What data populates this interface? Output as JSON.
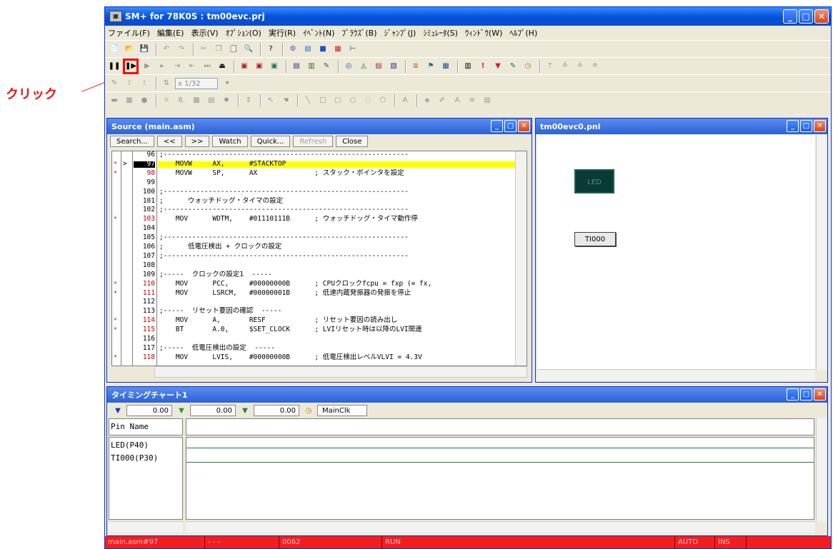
{
  "annotation": {
    "label": "クリック",
    "color": "#ee1111"
  },
  "app": {
    "title": "SM+ for 78K0S : tm00evc.prj",
    "menus": [
      "ファイル(F)",
      "編集(E)",
      "表示(V)",
      "ｵﾌﾟｼｮﾝ(O)",
      "実行(R)",
      "ｲﾍﾞﾝﾄ(N)",
      "ﾌﾞﾗｳｽﾞ(B)",
      "ｼﾞｬﾝﾌﾟ(J)",
      "ｼﾐｭﾚｰﾀ(S)",
      "ｳｨﾝﾄﾞｳ(W)",
      "ﾍﾙﾌﾟ(H)"
    ],
    "zoom": "x 1/32"
  },
  "source_window": {
    "title": "Source (main.asm)",
    "buttons": {
      "search": "Search...",
      "back": "<<",
      "forward": ">>",
      "watch": "Watch",
      "quick": "Quick...",
      "refresh": "Refresh",
      "close": "Close"
    },
    "lines": [
      {
        "n": "96",
        "text": ";------------------------------------------------------------",
        "bp": false,
        "red": false,
        "hl": false
      },
      {
        "n": "97",
        "text": "    MOVW     AX,      #STACKTOP",
        "bp": true,
        "red": true,
        "hl": true
      },
      {
        "n": "98",
        "text": "    MOVW     SP,      AX              ; スタック・ポインタを設定",
        "bp": true,
        "red": true,
        "hl": false
      },
      {
        "n": "99",
        "text": "",
        "bp": false,
        "red": false,
        "hl": false
      },
      {
        "n": "100",
        "text": ";------------------------------------------------------------",
        "bp": false,
        "red": false,
        "hl": false
      },
      {
        "n": "101",
        "text": ";      ウォッチドッグ・タイマの設定",
        "bp": false,
        "red": false,
        "hl": false
      },
      {
        "n": "102",
        "text": ";------------------------------------------------------------",
        "bp": false,
        "red": false,
        "hl": false
      },
      {
        "n": "103",
        "text": "    MOV      WDTM,    #01110111B      ; ウォッチドッグ・タイマ動作停",
        "bp": true,
        "red": true,
        "hl": false
      },
      {
        "n": "104",
        "text": "",
        "bp": false,
        "red": false,
        "hl": false
      },
      {
        "n": "105",
        "text": ";------------------------------------------------------------",
        "bp": false,
        "red": false,
        "hl": false
      },
      {
        "n": "106",
        "text": ";      低電圧検出 + クロックの設定",
        "bp": false,
        "red": false,
        "hl": false
      },
      {
        "n": "107",
        "text": ";------------------------------------------------------------",
        "bp": false,
        "red": false,
        "hl": false
      },
      {
        "n": "108",
        "text": "",
        "bp": false,
        "red": false,
        "hl": false
      },
      {
        "n": "109",
        "text": ";-----  クロックの設定1  -----",
        "bp": false,
        "red": false,
        "hl": false
      },
      {
        "n": "110",
        "text": "    MOV      PCC,     #00000000B      ; CPUクロックfcpu = fxp (= fx,",
        "bp": true,
        "red": true,
        "hl": false
      },
      {
        "n": "111",
        "text": "    MOV      LSRCM,   #00000001B      ; 低速内蔵発振器の発振を停止",
        "bp": true,
        "red": true,
        "hl": false
      },
      {
        "n": "112",
        "text": "",
        "bp": false,
        "red": false,
        "hl": false
      },
      {
        "n": "113",
        "text": ";-----  リセット要因の確認  -----",
        "bp": false,
        "red": false,
        "hl": false
      },
      {
        "n": "114",
        "text": "    MOV      A,       RESF            ; リセット要因の読み出し",
        "bp": true,
        "red": true,
        "hl": false
      },
      {
        "n": "115",
        "text": "    BT       A.0,     $SET_CLOCK      ; LVIリセット時は以降のLVI関連",
        "bp": true,
        "red": true,
        "hl": false
      },
      {
        "n": "116",
        "text": "",
        "bp": false,
        "red": false,
        "hl": false
      },
      {
        "n": "117",
        "text": ";-----  低電圧検出の設定  -----",
        "bp": false,
        "red": false,
        "hl": false
      },
      {
        "n": "118",
        "text": "    MOV      LVIS,    #00000000B      ; 低電圧検出レベルVLVI = 4.3V",
        "bp": true,
        "red": true,
        "hl": false
      }
    ]
  },
  "panel_window": {
    "title": "tm00evc0.pnl",
    "led_label": "LED",
    "ti_label": "TI000"
  },
  "timing_window": {
    "title": "タイミングチャート1",
    "cursor1": "0.00",
    "cursor2": "0.00",
    "cursor3": "0.00",
    "clock": "MainClk",
    "pin_header": "Pin Name",
    "pins": [
      "LED(P40)",
      "TI000(P30)"
    ]
  },
  "status": {
    "file_line": "main.asm#97",
    "dash": "- - -",
    "code": "0062",
    "state": "RUN",
    "mode": "AUTO",
    "ins": "INS"
  }
}
